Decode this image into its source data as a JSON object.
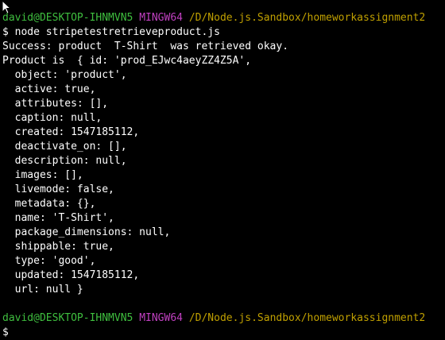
{
  "prompt1": {
    "user": "david@DESKTOP-IHNMVN5",
    "shell": "MINGW64",
    "path": "/D/Node.js.Sandbox/homeworkassignment2"
  },
  "command": "$ node stripetestretrieveproduct.js",
  "output": [
    "Success: product  T-Shirt  was retrieved okay.",
    "Product is  { id: 'prod_EJwc4aeyZZ4Z5A',",
    "  object: 'product',",
    "  active: true,",
    "  attributes: [],",
    "  caption: null,",
    "  created: 1547185112,",
    "  deactivate_on: [],",
    "  description: null,",
    "  images: [],",
    "  livemode: false,",
    "  metadata: {},",
    "  name: 'T-Shirt',",
    "  package_dimensions: null,",
    "  shippable: true,",
    "  type: 'good',",
    "  updated: 1547185112,",
    "  url: null }"
  ],
  "prompt2": {
    "user": "david@DESKTOP-IHNMVN5",
    "shell": "MINGW64",
    "path": "/D/Node.js.Sandbox/homeworkassignment2",
    "symbol": "$"
  },
  "colors": {
    "background": "#000000",
    "user": "#3fbf3f",
    "shell": "#c040c0",
    "path": "#c0a000",
    "text": "#ffffff"
  },
  "icons": {
    "pointer": "mouse-pointer-icon"
  }
}
